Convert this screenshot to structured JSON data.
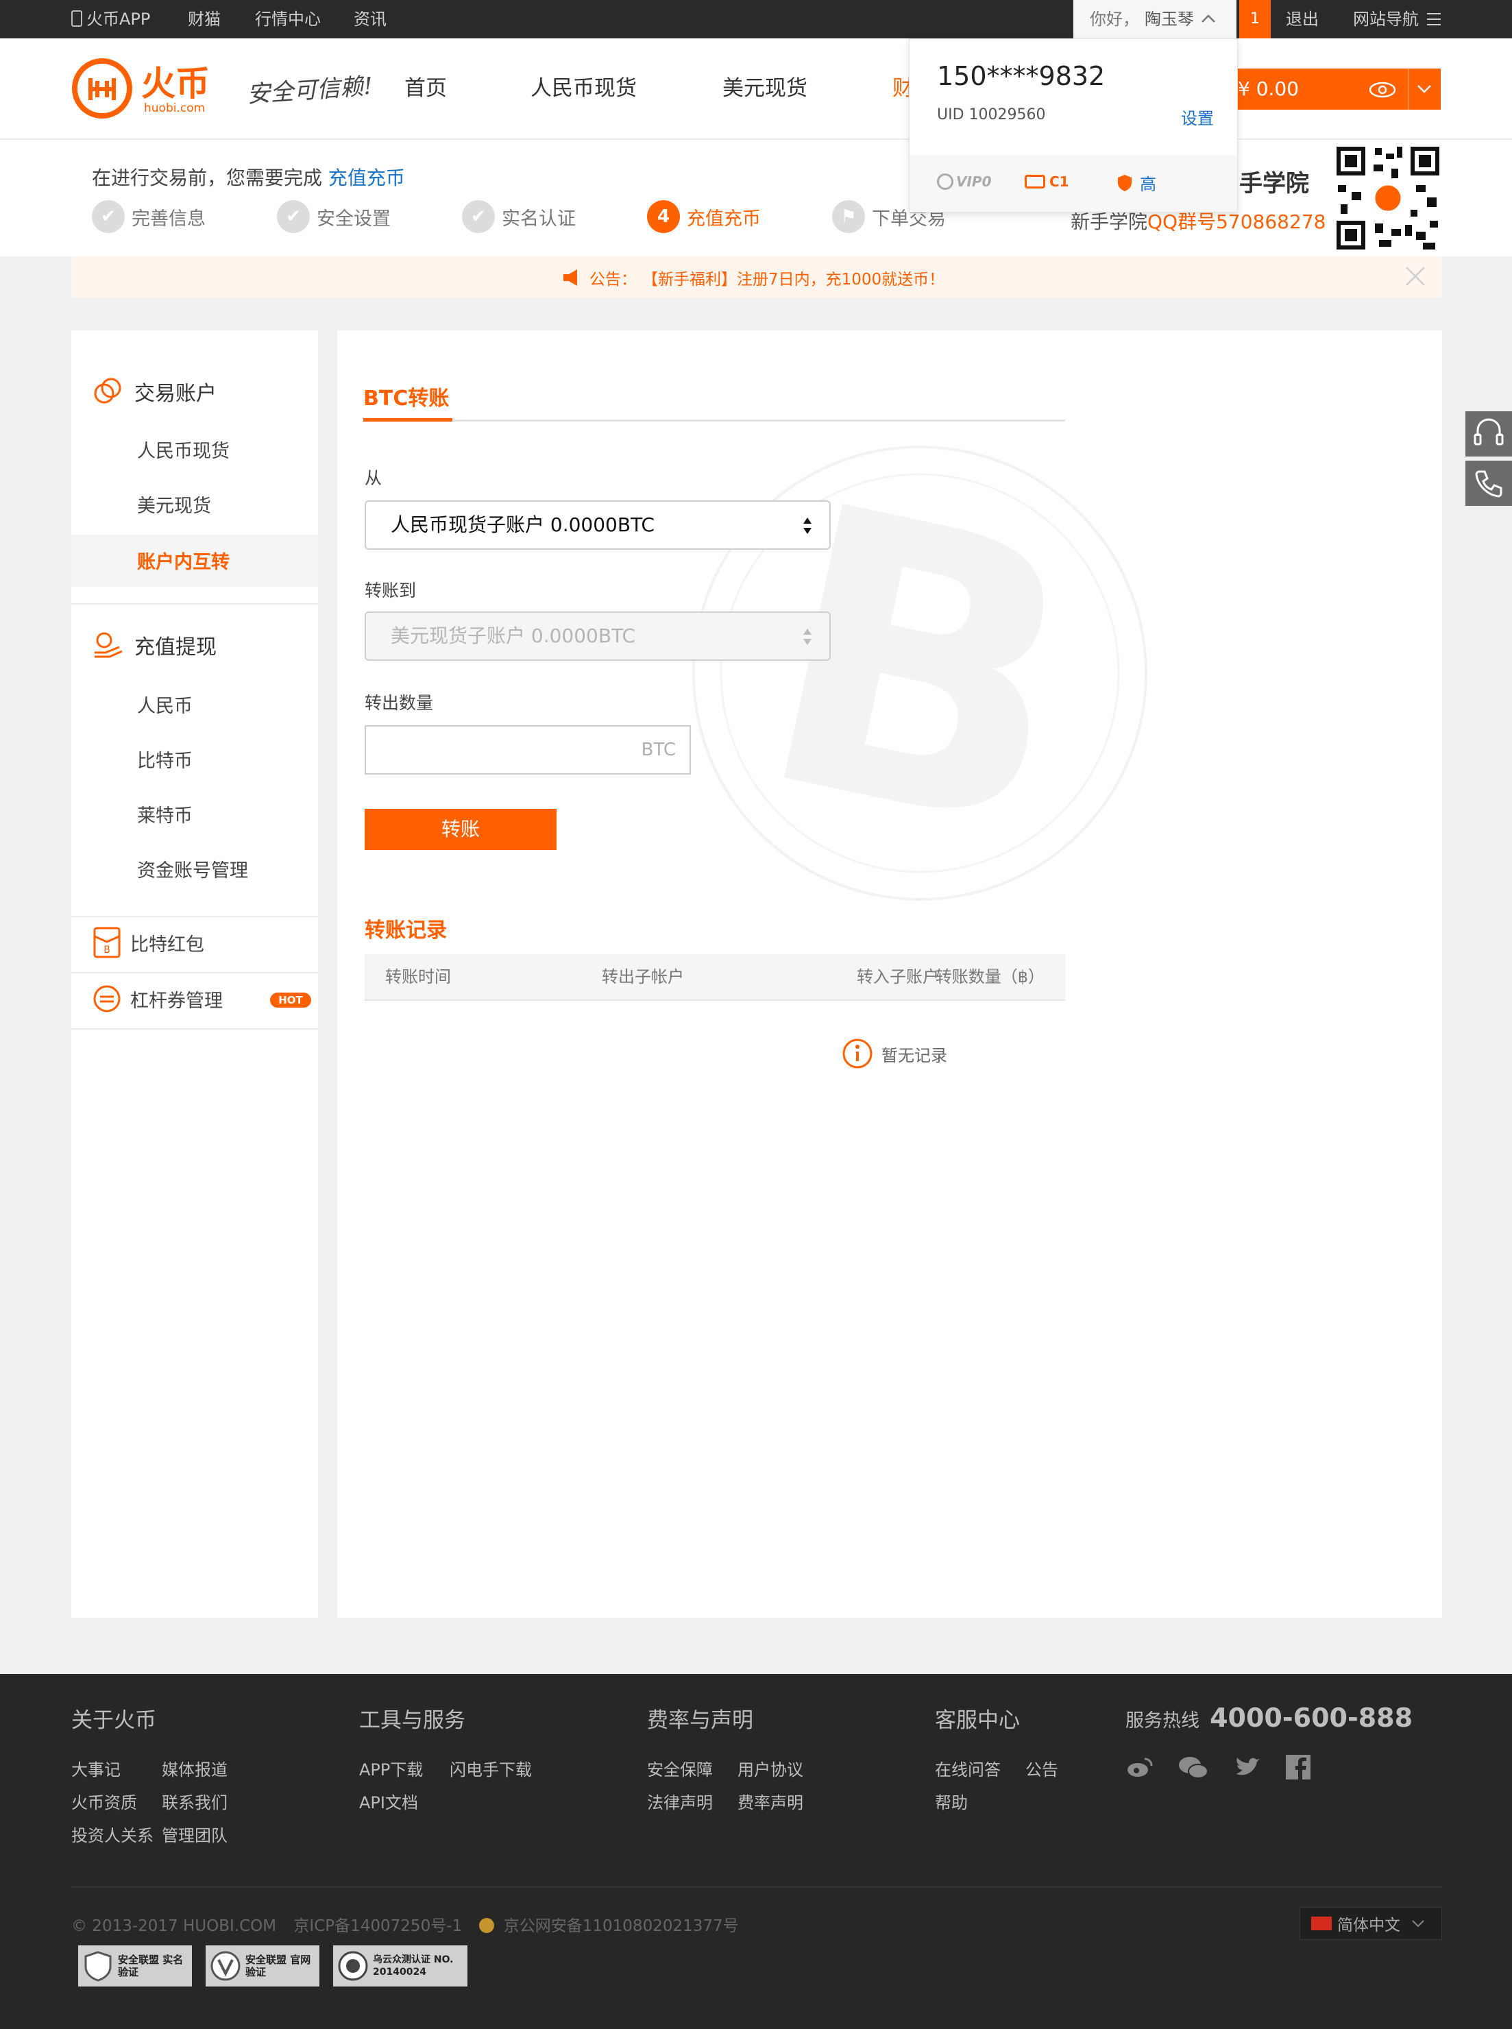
{
  "topbar": {
    "app_label": "火币APP",
    "links": [
      "财猫",
      "行情中心",
      "资讯"
    ],
    "greeting": "你好，",
    "username": "陶玉琴",
    "badge_count": "1",
    "logout": "退出",
    "site_nav": "网站导航"
  },
  "header": {
    "logo_cn": "火币",
    "logo_en": "huobi.com",
    "slogan": "安全可信赖!",
    "nav": [
      "首页",
      "人民币现货",
      "美元现货",
      "财"
    ],
    "balance": "¥ 0.00"
  },
  "dropdown": {
    "phone": "150****9832",
    "uid": "UID 10029560",
    "settings": "设置",
    "vip": "VIP0",
    "credit": "C1",
    "security": "高"
  },
  "progress": {
    "hint_prefix": "在进行交易前，您需要完成",
    "hint_link": "充值充币",
    "steps": [
      "完善信息",
      "安全设置",
      "实名认证",
      "充值充币",
      "下单交易"
    ],
    "active_num": "4",
    "academy_title": "手学院",
    "academy_qq_prefix": "新手学院",
    "academy_qq": "QQ群号570868278"
  },
  "notice": {
    "label": "公告：",
    "text": "【新手福利】注册7日内，充1000就送币！"
  },
  "sidebar": {
    "trade_account": "交易账户",
    "trade_items": [
      "人民币现货",
      "美元现货",
      "账户内互转"
    ],
    "deposit": "充值提现",
    "deposit_items": [
      "人民币",
      "比特币",
      "莱特币",
      "资金账号管理"
    ],
    "red_packet": "比特红包",
    "leverage": "杠杆券管理",
    "hot": "HOT"
  },
  "main": {
    "title": "BTC转账",
    "from_label": "从",
    "from_value": "人民币现货子账户 0.0000BTC",
    "to_label": "转账到",
    "to_value": "美元现货子账户 0.0000BTC",
    "amount_label": "转出数量",
    "amount_placeholder": "BTC",
    "submit": "转账",
    "records_title": "转账记录",
    "columns": [
      "转账时间",
      "转出子帐户",
      "转入子账户",
      "转账数量（฿）"
    ],
    "empty": "暂无记录"
  },
  "footer": {
    "cols": [
      {
        "title": "关于火币",
        "links": [
          "大事记",
          "媒体报道",
          "火币资质",
          "联系我们",
          "投资人关系",
          "管理团队"
        ]
      },
      {
        "title": "工具与服务",
        "links": [
          "APP下载",
          "闪电手下载",
          "API文档"
        ]
      },
      {
        "title": "费率与声明",
        "links": [
          "安全保障",
          "用户协议",
          "法律声明",
          "费率声明"
        ]
      },
      {
        "title": "客服中心",
        "links": [
          "在线问答",
          "公告",
          "帮助"
        ]
      }
    ],
    "hotline_label": "服务热线",
    "hotline": "4000-600-888",
    "copyright": "© 2013-2017 HUOBI.COM",
    "icp": "京ICP备14007250号-1",
    "police": "京公网安备11010802021377号",
    "language": "简体中文",
    "badges": [
      "安全联盟 实名验证",
      "安全联盟 官网验证",
      "乌云众测认证 NO. 20140024"
    ]
  },
  "colors": {
    "accent": "#ff6000",
    "link": "#1a73c9",
    "dark": "#2a2a2a"
  }
}
